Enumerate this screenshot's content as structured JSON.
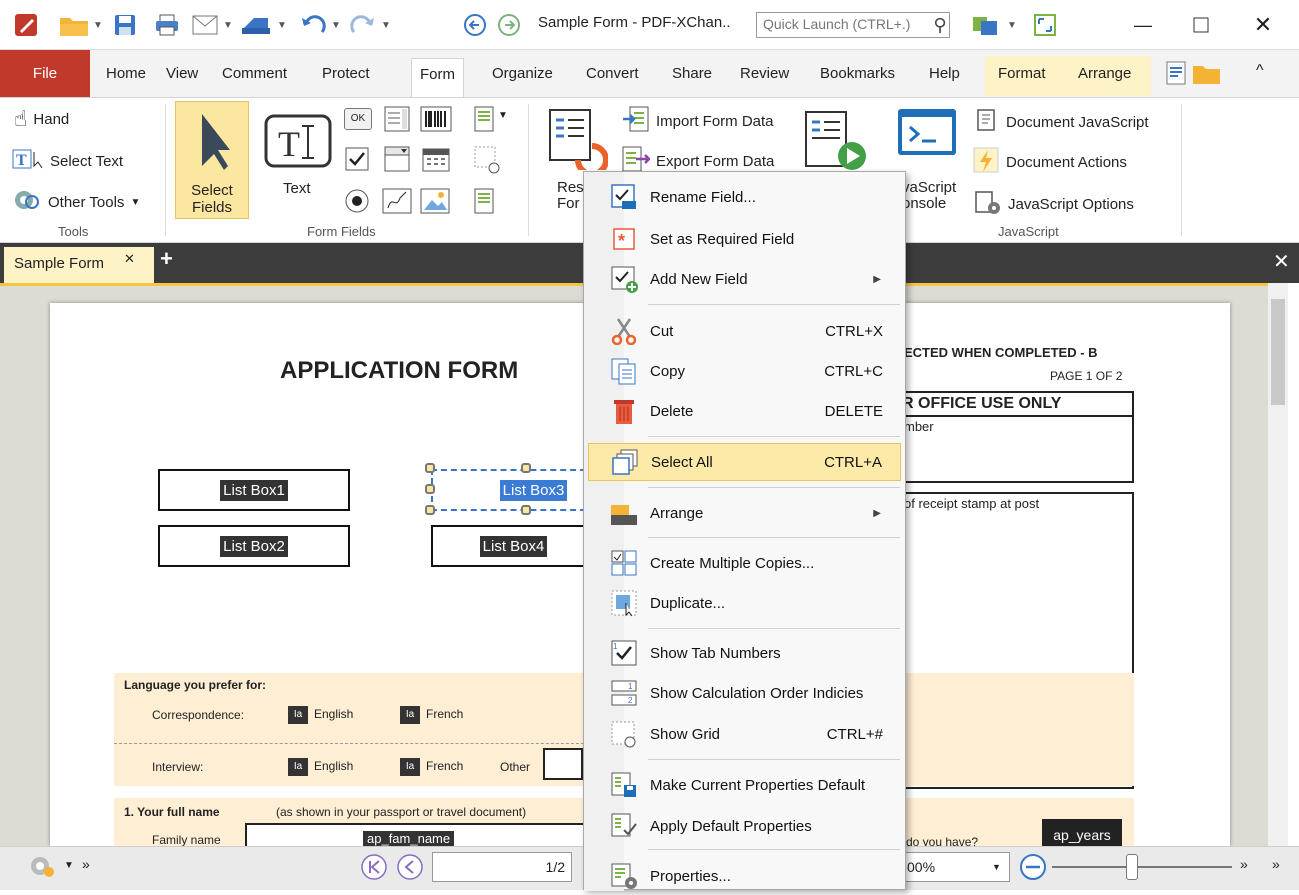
{
  "window": {
    "title": "Sample Form - PDF-XChan..",
    "quick_launch_placeholder": "Quick Launch (CTRL+.)"
  },
  "menu": {
    "file": "File",
    "items": [
      "Home",
      "View",
      "Comment",
      "Protect",
      "Form",
      "Organize",
      "Convert",
      "Share",
      "Review",
      "Bookmarks",
      "Help"
    ],
    "contextual": [
      "Format",
      "Arrange"
    ]
  },
  "ribbon": {
    "tools": {
      "hand": "Hand",
      "select_text": "Select Text",
      "other_tools": "Other Tools",
      "label": "Tools"
    },
    "select_fields": {
      "line1": "Select",
      "line2": "Fields"
    },
    "form_fields": {
      "text": "Text",
      "label": "Form Fields",
      "ok": "OK"
    },
    "form_data": {
      "import": "Import Form Data",
      "export": "Export Form Data",
      "reset_partial1": "Res",
      "reset_partial2": "For"
    },
    "javascript": {
      "console1": "vaScript",
      "console2": "onsole",
      "document_js": "Document JavaScript",
      "document_actions": "Document Actions",
      "js_options": "JavaScript Options",
      "label": "JavaScript"
    }
  },
  "doc_tab": {
    "name": "Sample Form"
  },
  "form": {
    "title": "APPLICATION FORM",
    "list_boxes": [
      "List Box1",
      "List Box2",
      "List Box3",
      "List Box4"
    ],
    "header_right": "ECTED WHEN COMPLETED - B",
    "page_of": "PAGE 1 OF 2",
    "office_use": "R OFFICE USE ONLY",
    "number_partial": "mber",
    "receipt": "of receipt stamp at post",
    "language_heading": "Language you prefer for:",
    "correspondence": "Correspondence:",
    "interview": "Interview:",
    "english": "English",
    "french": "French",
    "other": "Other",
    "fullname": "1.   Your full name",
    "fullname_note": "(as shown in your passport or travel document)",
    "family_name": "Family name",
    "fam_field": "ap_fam_name",
    "years_field": "ap_years",
    "do_you_have": "do you have?"
  },
  "context_menu": [
    {
      "label": "Rename Field...",
      "icon": "rename-field-icon"
    },
    {
      "label": "Set as Required Field",
      "icon": "required-asterisk-icon"
    },
    {
      "label": "Add New Field",
      "icon": "add-field-icon",
      "submenu": true
    },
    {
      "label": "Cut",
      "shortcut": "CTRL+X",
      "icon": "scissors-icon"
    },
    {
      "label": "Copy",
      "shortcut": "CTRL+C",
      "icon": "copy-icon"
    },
    {
      "label": "Delete",
      "shortcut": "DELETE",
      "icon": "trash-icon"
    },
    {
      "label": "Select All",
      "shortcut": "CTRL+A",
      "icon": "select-all-icon",
      "highlighted": true
    },
    {
      "label": "Arrange",
      "icon": "arrange-icon",
      "submenu": true
    },
    {
      "label": "Create Multiple Copies...",
      "icon": "multiple-copies-icon"
    },
    {
      "label": "Duplicate...",
      "icon": "duplicate-icon"
    },
    {
      "label": "Show Tab Numbers",
      "icon": "tab-numbers-icon"
    },
    {
      "label": "Show Calculation Order Indicies",
      "icon": "calc-order-icon"
    },
    {
      "label": "Show Grid",
      "shortcut": "CTRL+#",
      "icon": "grid-icon"
    },
    {
      "label": "Make Current Properties Default",
      "icon": "make-default-icon"
    },
    {
      "label": "Apply Default Properties",
      "icon": "apply-default-icon"
    },
    {
      "label": "Properties...",
      "icon": "properties-icon"
    }
  ],
  "status": {
    "page": "1/2",
    "zoom": "00%"
  }
}
